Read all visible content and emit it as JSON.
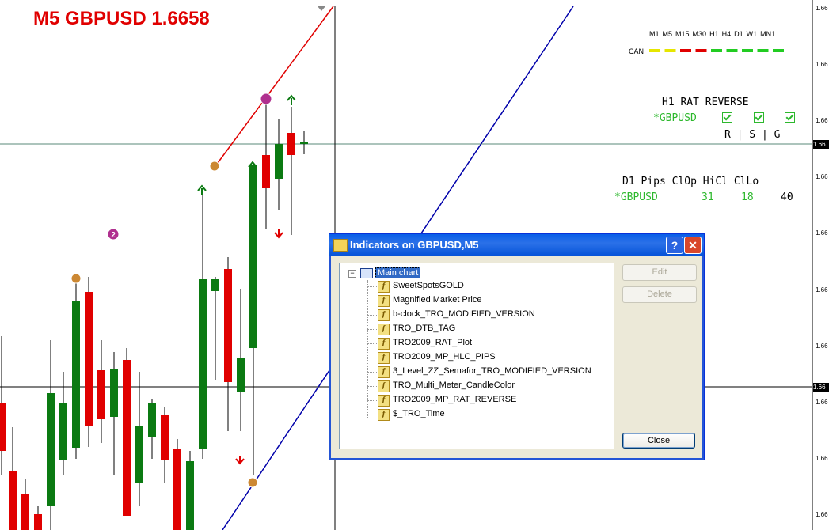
{
  "chart": {
    "title": "M5 GBPUSD 1.6658",
    "timeframes": [
      "M1",
      "M5",
      "M15",
      "M30",
      "H1",
      "H4",
      "D1",
      "W1",
      "MN1"
    ],
    "can_label": "CAN",
    "can_colors": [
      "#e6e600",
      "#e6e600",
      "#e00000",
      "#e00000",
      "#22cc22",
      "#22cc22",
      "#22cc22",
      "#22cc22",
      "#22cc22"
    ],
    "rat_title": "H1 RAT REVERSE",
    "rat_symbol": "*GBPUSD",
    "rat_rsg": "R | S | G",
    "d1_header": "D1 Pips ClOp HiCl ClLo",
    "d1_symbol": "*GBPUSD",
    "d1_values": [
      "31",
      "18",
      "40"
    ],
    "d1_value_colors": [
      "#2db82d",
      "#2db82d",
      "#000000"
    ],
    "semafor_label": "2",
    "price_axis_labels": [
      "1.66",
      "1.66",
      "1.66",
      "1.66",
      "1.66",
      "1.66",
      "1.66",
      "1.66",
      "1.66",
      "1.66"
    ],
    "price_tags": [
      "1.66",
      "1.66"
    ],
    "bull_color": "#0b7a12",
    "bear_color": "#e00000"
  },
  "dialog": {
    "title": "Indicators on GBPUSD,M5",
    "help_label": "?",
    "close_x_label": "✕",
    "root_label": "Main chart",
    "indicators": [
      "SweetSpotsGOLD",
      "Magnified Market Price",
      "b-clock_TRO_MODIFIED_VERSION",
      "TRO_DTB_TAG",
      "TRO2009_RAT_Plot",
      "TRO2009_MP_HLC_PIPS",
      "3_Level_ZZ_Semafor_TRO_MODIFIED_VERSION",
      "TRO_Multi_Meter_CandleColor",
      "TRO2009_MP_RAT_REVERSE",
      "$_TRO_Time"
    ],
    "edit_label": "Edit",
    "delete_label": "Delete",
    "close_label": "Close"
  }
}
